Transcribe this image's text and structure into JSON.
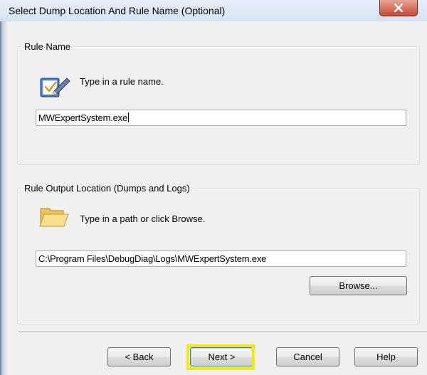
{
  "window": {
    "title": "Select Dump Location And Rule Name (Optional)"
  },
  "rule_name_group": {
    "legend": "Rule Name",
    "hint": "Type in a rule name.",
    "input_value": "MWExpertSystem.exe"
  },
  "output_group": {
    "legend": "Rule Output Location (Dumps and Logs)",
    "hint": "Type in a path or click Browse.",
    "input_value": "C:\\Program Files\\DebugDiag\\Logs\\MWExpertSystem.exe",
    "browse_label": "Browse..."
  },
  "buttons": {
    "back": "< Back",
    "next": "Next >",
    "cancel": "Cancel",
    "help": "Help"
  },
  "colors": {
    "highlight": "#f5ea00",
    "close": "#c74a33"
  }
}
